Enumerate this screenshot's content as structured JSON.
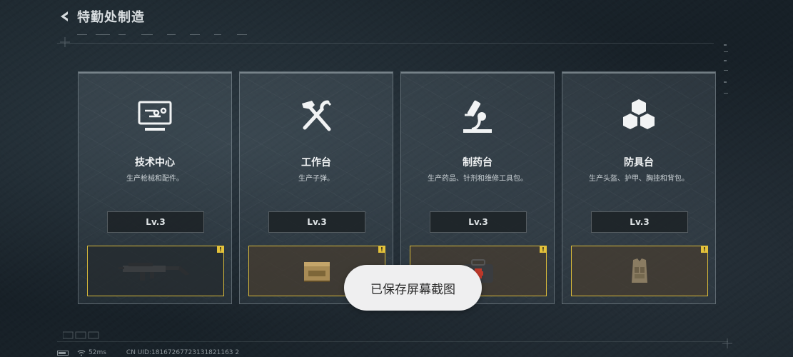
{
  "header": {
    "title": "特勤处制造"
  },
  "cards": [
    {
      "name": "技术中心",
      "desc": "生产枪械和配件。",
      "level": "Lv.3",
      "alert": "!"
    },
    {
      "name": "工作台",
      "desc": "生产子弹。",
      "level": "Lv.3",
      "alert": "!"
    },
    {
      "name": "制药台",
      "desc": "生产药品、针剂和维修工具包。",
      "level": "Lv.3",
      "alert": "!"
    },
    {
      "name": "防具台",
      "desc": "生产头盔、护甲、胸挂和背包。",
      "level": "Lv.3",
      "alert": "!"
    }
  ],
  "toast": "已保存屏幕截图",
  "status": {
    "ping": "52ms",
    "uid": "CN UID:18167267723131821163 2"
  },
  "colors": {
    "accent": "#d8b93a",
    "alert": "#e4c23a"
  },
  "icons": [
    "computer-icon",
    "hammer-wrench-icon",
    "microscope-icon",
    "cubes-icon"
  ]
}
